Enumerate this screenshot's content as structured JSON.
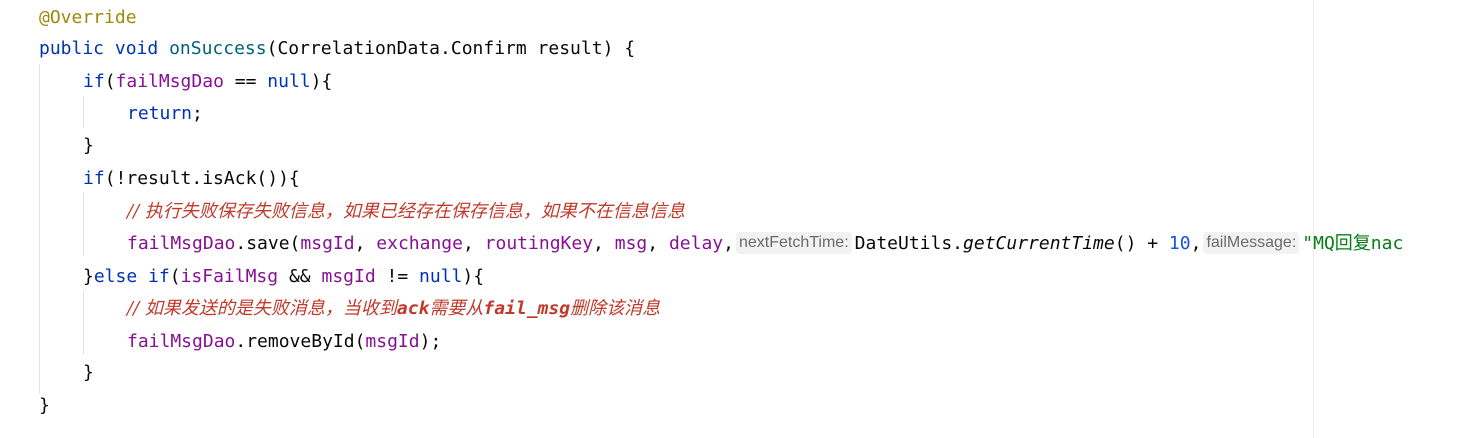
{
  "code": {
    "annotation": "@Override",
    "sig_public": "public",
    "sig_void": "void",
    "sig_method": "onSuccess",
    "sig_params": "(CorrelationData.Confirm result) {",
    "kw_if": "if",
    "field_dao": "failMsgDao",
    "op_eq": " == ",
    "kw_null": "null",
    "close_paren_brace": "){",
    "kw_return": "return",
    "semicolon": ";",
    "close_brace": "}",
    "cond_not_ack": "(!result.isAck()){",
    "comment1_slash": "// ",
    "comment1_text": "执行失败保存失败信息，如果已经存在保存信息，如果不在信息信息",
    "save_call": ".save(",
    "arg_msgId": "msgId",
    "arg_exchange": "exchange",
    "arg_routingKey": "routingKey",
    "arg_msg": "msg",
    "arg_delay": "delay",
    "comma": ", ",
    "hint_nextFetchTime": "nextFetchTime:",
    "date_utils": "DateUtils.",
    "get_current_time": "getCurrentTime",
    "call_plus": "() + ",
    "num_10": "10",
    "hint_failMessage": "failMessage:",
    "str_mq": "\"MQ回复nac",
    "else_kw": "else",
    "field_isFailMsg": "isFailMsg",
    "op_and": " && ",
    "op_neq": " != ",
    "comment2_text_a": "如果发送的是失败消息，当收到",
    "comment2_ack": "ack",
    "comment2_text_b": "需要从",
    "comment2_failmsg": "fail_msg",
    "comment2_text_c": "删除该消息",
    "remove_call": ".removeById(",
    "close_paren_semicolon": ");"
  },
  "colors": {
    "keyword": "#0033b3",
    "field": "#871094",
    "annotation": "#9e880d",
    "method": "#00627a",
    "number": "#1750eb",
    "string": "#067d17",
    "comment": "#c0392b",
    "inlay_hint_bg": "#f2f2f2"
  }
}
